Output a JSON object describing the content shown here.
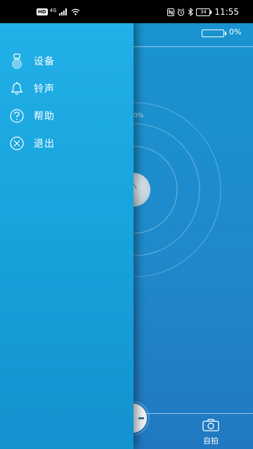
{
  "status_bar": {
    "left_badge": "HD",
    "network": "4G",
    "battery_level": "34",
    "time": "11:55"
  },
  "main": {
    "battery_percent": "0%",
    "ring_percent": "0%",
    "camera_label": "自拍"
  },
  "drawer": {
    "items": [
      {
        "label": "设备",
        "icon": "device-icon"
      },
      {
        "label": "铃声",
        "icon": "bell-icon"
      },
      {
        "label": "帮助",
        "icon": "help-icon"
      },
      {
        "label": "退出",
        "icon": "exit-icon"
      }
    ]
  },
  "colors": {
    "drawer_top": "#22b0e8",
    "drawer_bottom": "#1392d0",
    "main_bg": "#1a94d0"
  }
}
